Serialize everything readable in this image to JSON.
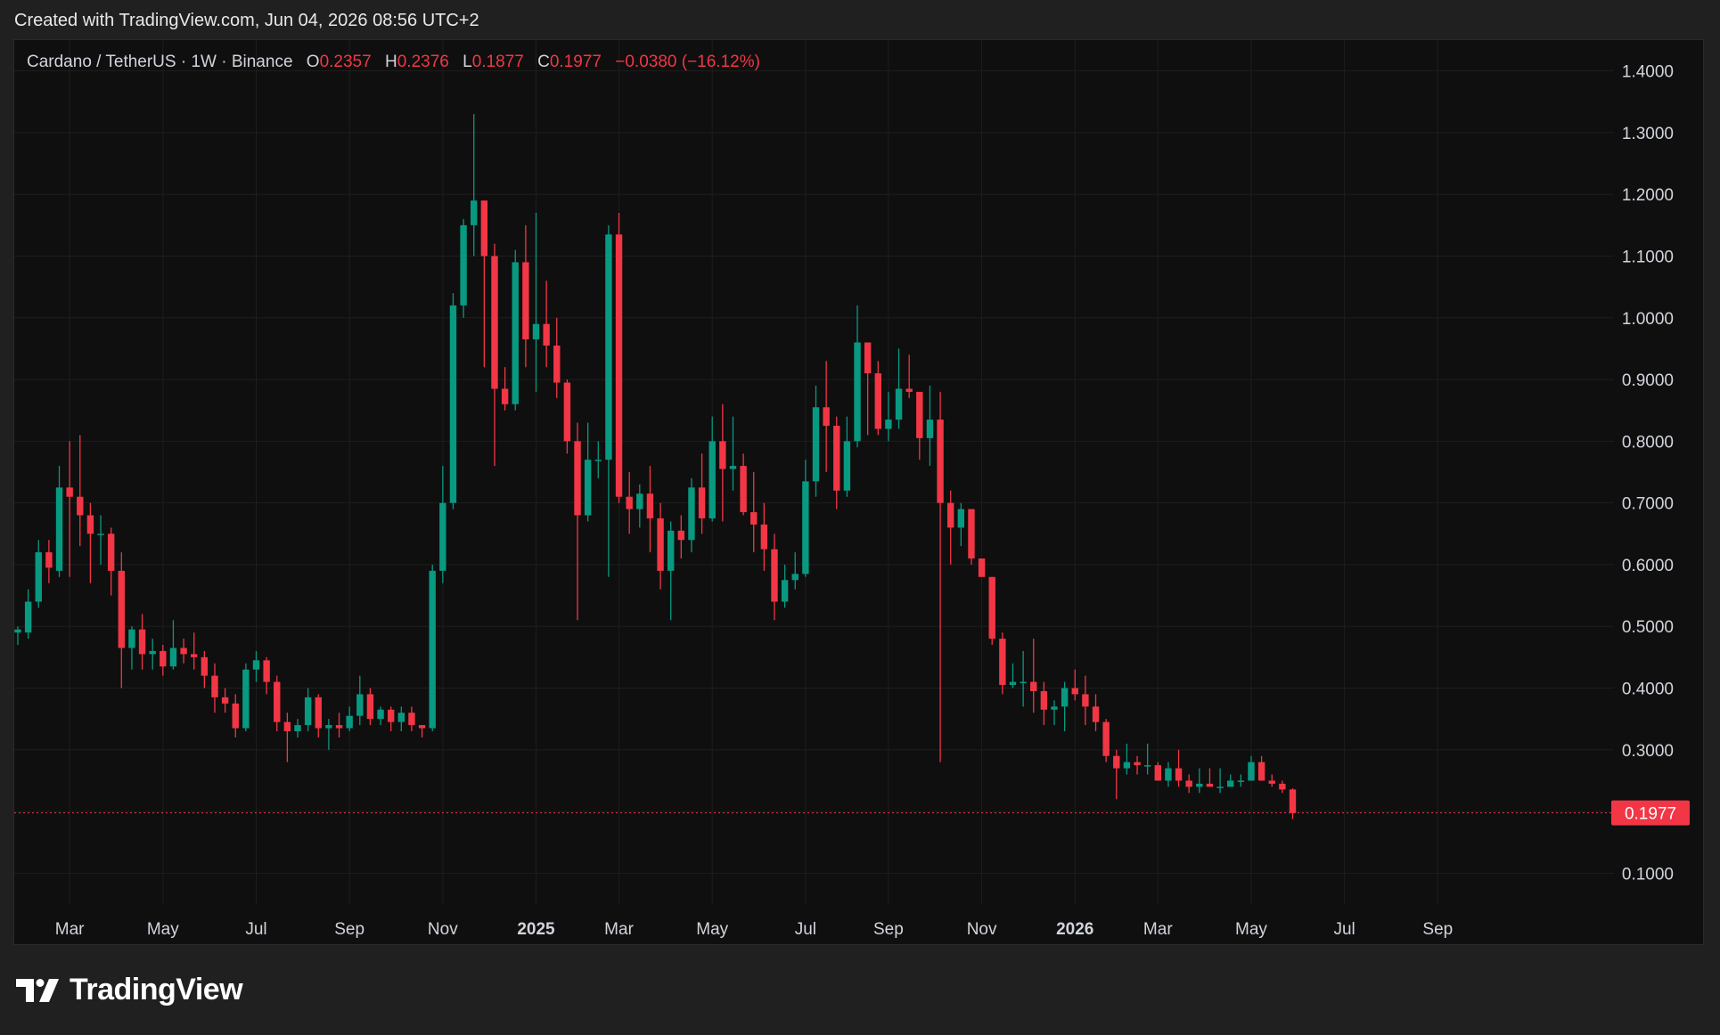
{
  "caption": "Created with TradingView.com, Jun 04, 2026 08:56 UTC+2",
  "brand": {
    "name": "TradingView",
    "icon": "tradingview-logo-icon"
  },
  "legend": {
    "symbol": "Cardano / TetherUS · 1W · Binance",
    "open_label": "O",
    "open": "0.2357",
    "high_label": "H",
    "high": "0.2376",
    "low_label": "L",
    "low": "0.1877",
    "close_label": "C",
    "close": "0.1977",
    "change": "−0.0380 (−16.12%)"
  },
  "colors": {
    "up": "#089981",
    "down": "#f23645",
    "grid": "#1e1e1e",
    "background": "#0f0f0f"
  },
  "chart_data": {
    "type": "candlestick",
    "title": "Cardano / TetherUS · 1W · Binance",
    "ylim": [
      0.05,
      1.45
    ],
    "y_ticks": [
      "0.1000",
      "0.2000",
      "0.3000",
      "0.4000",
      "0.5000",
      "0.6000",
      "0.7000",
      "0.8000",
      "0.9000",
      "1.0000",
      "1.1000",
      "1.2000",
      "1.3000",
      "1.4000"
    ],
    "x_ticks": [
      {
        "label": "Mar",
        "i": 5,
        "bold": false
      },
      {
        "label": "May",
        "i": 14,
        "bold": false
      },
      {
        "label": "Jul",
        "i": 23,
        "bold": false
      },
      {
        "label": "Sep",
        "i": 32,
        "bold": false
      },
      {
        "label": "Nov",
        "i": 41,
        "bold": false
      },
      {
        "label": "2025",
        "i": 50,
        "bold": true
      },
      {
        "label": "Mar",
        "i": 58,
        "bold": false
      },
      {
        "label": "May",
        "i": 67,
        "bold": false
      },
      {
        "label": "Jul",
        "i": 76,
        "bold": false
      },
      {
        "label": "Sep",
        "i": 84,
        "bold": false
      },
      {
        "label": "Nov",
        "i": 93,
        "bold": false
      },
      {
        "label": "2026",
        "i": 102,
        "bold": true
      },
      {
        "label": "Mar",
        "i": 110,
        "bold": false
      },
      {
        "label": "May",
        "i": 119,
        "bold": false
      },
      {
        "label": "Jul",
        "i": 128,
        "bold": false
      },
      {
        "label": "Sep",
        "i": 137,
        "bold": false
      }
    ],
    "last_price": "0.1977",
    "candles": [
      [
        0.49,
        0.495,
        0.47,
        0.5
      ],
      [
        0.49,
        0.54,
        0.48,
        0.56
      ],
      [
        0.54,
        0.62,
        0.53,
        0.64
      ],
      [
        0.62,
        0.595,
        0.57,
        0.64
      ],
      [
        0.59,
        0.725,
        0.58,
        0.76
      ],
      [
        0.725,
        0.71,
        0.58,
        0.8
      ],
      [
        0.71,
        0.68,
        0.63,
        0.81
      ],
      [
        0.68,
        0.65,
        0.57,
        0.7
      ],
      [
        0.65,
        0.65,
        0.6,
        0.68
      ],
      [
        0.65,
        0.59,
        0.55,
        0.66
      ],
      [
        0.59,
        0.465,
        0.4,
        0.62
      ],
      [
        0.465,
        0.495,
        0.43,
        0.5
      ],
      [
        0.495,
        0.455,
        0.43,
        0.52
      ],
      [
        0.455,
        0.46,
        0.43,
        0.48
      ],
      [
        0.46,
        0.435,
        0.42,
        0.47
      ],
      [
        0.435,
        0.465,
        0.43,
        0.51
      ],
      [
        0.465,
        0.455,
        0.44,
        0.48
      ],
      [
        0.455,
        0.45,
        0.43,
        0.49
      ],
      [
        0.45,
        0.42,
        0.4,
        0.46
      ],
      [
        0.42,
        0.385,
        0.36,
        0.44
      ],
      [
        0.385,
        0.375,
        0.36,
        0.4
      ],
      [
        0.375,
        0.335,
        0.32,
        0.39
      ],
      [
        0.335,
        0.43,
        0.33,
        0.44
      ],
      [
        0.43,
        0.445,
        0.41,
        0.46
      ],
      [
        0.445,
        0.41,
        0.39,
        0.45
      ],
      [
        0.41,
        0.345,
        0.33,
        0.42
      ],
      [
        0.345,
        0.33,
        0.28,
        0.36
      ],
      [
        0.33,
        0.34,
        0.32,
        0.35
      ],
      [
        0.34,
        0.385,
        0.33,
        0.4
      ],
      [
        0.385,
        0.335,
        0.32,
        0.39
      ],
      [
        0.335,
        0.34,
        0.3,
        0.35
      ],
      [
        0.34,
        0.335,
        0.32,
        0.36
      ],
      [
        0.335,
        0.355,
        0.33,
        0.37
      ],
      [
        0.355,
        0.39,
        0.34,
        0.42
      ],
      [
        0.39,
        0.35,
        0.34,
        0.4
      ],
      [
        0.35,
        0.365,
        0.34,
        0.37
      ],
      [
        0.365,
        0.345,
        0.33,
        0.37
      ],
      [
        0.345,
        0.36,
        0.33,
        0.37
      ],
      [
        0.36,
        0.34,
        0.33,
        0.37
      ],
      [
        0.34,
        0.335,
        0.32,
        0.34
      ],
      [
        0.335,
        0.59,
        0.33,
        0.6
      ],
      [
        0.59,
        0.7,
        0.57,
        0.76
      ],
      [
        0.7,
        1.02,
        0.69,
        1.04
      ],
      [
        1.02,
        1.15,
        1.0,
        1.16
      ],
      [
        1.15,
        1.19,
        1.1,
        1.33
      ],
      [
        1.19,
        1.1,
        0.92,
        1.19
      ],
      [
        1.1,
        0.885,
        0.76,
        1.12
      ],
      [
        0.885,
        0.86,
        0.85,
        0.92
      ],
      [
        0.86,
        1.09,
        0.85,
        1.11
      ],
      [
        1.09,
        0.965,
        0.92,
        1.15
      ],
      [
        0.965,
        0.99,
        0.88,
        1.17
      ],
      [
        0.99,
        0.955,
        0.92,
        1.06
      ],
      [
        0.955,
        0.895,
        0.87,
        1.0
      ],
      [
        0.895,
        0.8,
        0.78,
        0.9
      ],
      [
        0.8,
        0.68,
        0.51,
        0.83
      ],
      [
        0.68,
        0.77,
        0.67,
        0.83
      ],
      [
        0.77,
        0.77,
        0.74,
        0.8
      ],
      [
        0.77,
        1.135,
        0.58,
        1.15
      ],
      [
        1.135,
        0.71,
        0.7,
        1.17
      ],
      [
        0.71,
        0.69,
        0.65,
        0.75
      ],
      [
        0.69,
        0.715,
        0.66,
        0.73
      ],
      [
        0.715,
        0.675,
        0.62,
        0.76
      ],
      [
        0.675,
        0.59,
        0.56,
        0.7
      ],
      [
        0.59,
        0.655,
        0.51,
        0.67
      ],
      [
        0.655,
        0.64,
        0.61,
        0.68
      ],
      [
        0.64,
        0.725,
        0.62,
        0.74
      ],
      [
        0.725,
        0.675,
        0.65,
        0.78
      ],
      [
        0.675,
        0.8,
        0.67,
        0.84
      ],
      [
        0.8,
        0.755,
        0.67,
        0.86
      ],
      [
        0.755,
        0.76,
        0.72,
        0.84
      ],
      [
        0.76,
        0.685,
        0.68,
        0.78
      ],
      [
        0.685,
        0.665,
        0.62,
        0.75
      ],
      [
        0.665,
        0.625,
        0.59,
        0.7
      ],
      [
        0.625,
        0.54,
        0.51,
        0.65
      ],
      [
        0.54,
        0.575,
        0.53,
        0.6
      ],
      [
        0.575,
        0.585,
        0.56,
        0.62
      ],
      [
        0.585,
        0.735,
        0.58,
        0.77
      ],
      [
        0.735,
        0.855,
        0.71,
        0.89
      ],
      [
        0.855,
        0.825,
        0.75,
        0.93
      ],
      [
        0.825,
        0.72,
        0.69,
        0.84
      ],
      [
        0.72,
        0.8,
        0.71,
        0.84
      ],
      [
        0.8,
        0.96,
        0.79,
        1.02
      ],
      [
        0.96,
        0.91,
        0.81,
        0.96
      ],
      [
        0.91,
        0.82,
        0.81,
        0.93
      ],
      [
        0.82,
        0.835,
        0.8,
        0.88
      ],
      [
        0.835,
        0.885,
        0.82,
        0.95
      ],
      [
        0.885,
        0.88,
        0.87,
        0.94
      ],
      [
        0.88,
        0.805,
        0.77,
        0.88
      ],
      [
        0.805,
        0.835,
        0.76,
        0.89
      ],
      [
        0.835,
        0.7,
        0.28,
        0.88
      ],
      [
        0.7,
        0.66,
        0.6,
        0.72
      ],
      [
        0.66,
        0.69,
        0.63,
        0.7
      ],
      [
        0.69,
        0.61,
        0.6,
        0.69
      ],
      [
        0.61,
        0.58,
        0.59,
        0.61
      ],
      [
        0.58,
        0.48,
        0.47,
        0.58
      ],
      [
        0.48,
        0.405,
        0.39,
        0.49
      ],
      [
        0.405,
        0.41,
        0.4,
        0.44
      ],
      [
        0.41,
        0.41,
        0.37,
        0.46
      ],
      [
        0.41,
        0.395,
        0.36,
        0.48
      ],
      [
        0.395,
        0.365,
        0.34,
        0.41
      ],
      [
        0.365,
        0.37,
        0.34,
        0.38
      ],
      [
        0.37,
        0.4,
        0.33,
        0.41
      ],
      [
        0.4,
        0.39,
        0.38,
        0.43
      ],
      [
        0.39,
        0.37,
        0.34,
        0.42
      ],
      [
        0.37,
        0.345,
        0.33,
        0.39
      ],
      [
        0.345,
        0.29,
        0.28,
        0.35
      ],
      [
        0.29,
        0.27,
        0.22,
        0.3
      ],
      [
        0.27,
        0.28,
        0.26,
        0.31
      ],
      [
        0.28,
        0.275,
        0.26,
        0.29
      ],
      [
        0.275,
        0.275,
        0.26,
        0.31
      ],
      [
        0.275,
        0.25,
        0.25,
        0.28
      ],
      [
        0.25,
        0.27,
        0.24,
        0.28
      ],
      [
        0.27,
        0.25,
        0.24,
        0.3
      ],
      [
        0.25,
        0.24,
        0.23,
        0.26
      ],
      [
        0.24,
        0.245,
        0.23,
        0.27
      ],
      [
        0.245,
        0.24,
        0.24,
        0.27
      ],
      [
        0.24,
        0.24,
        0.23,
        0.27
      ],
      [
        0.24,
        0.25,
        0.24,
        0.26
      ],
      [
        0.25,
        0.25,
        0.24,
        0.26
      ],
      [
        0.25,
        0.28,
        0.25,
        0.29
      ],
      [
        0.28,
        0.25,
        0.25,
        0.29
      ],
      [
        0.25,
        0.245,
        0.24,
        0.26
      ],
      [
        0.245,
        0.2357,
        0.23,
        0.25
      ],
      [
        0.2357,
        0.1977,
        0.1877,
        0.2376
      ]
    ]
  }
}
